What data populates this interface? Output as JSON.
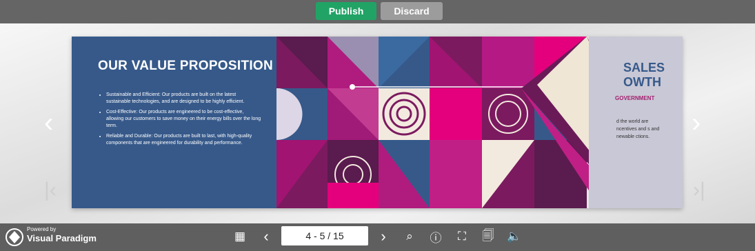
{
  "toolbar": {
    "publish_label": "Publish",
    "discard_label": "Discard"
  },
  "page_left": {
    "title": "OUR VALUE PROPOSITION",
    "bullets": [
      "Sustainable and Efficient: Our products are built on the latest sustainable technologies, and are designed to be highly efficient.",
      "Cost-Effective: Our products are engineered to be cost-effective, allowing our customers to save money on their energy bills over the long term.",
      "Reliable and Durable: Our products are built to last, with high-quality components that are engineered for durability and performance."
    ]
  },
  "page_right": {
    "title": "SALES  OWTH",
    "subtitle": "GOVERNMENT",
    "text": "d the world are ncentives and s and newable ctions."
  },
  "viewer": {
    "page_indicator": "4 - 5 / 15",
    "brand_powered": "Powered by",
    "brand_name": "Visual Paradigm"
  },
  "colors": {
    "navy": "#36598a",
    "magenta": "#e4007c",
    "plum": "#7b1a5f",
    "publish": "#21a366"
  }
}
